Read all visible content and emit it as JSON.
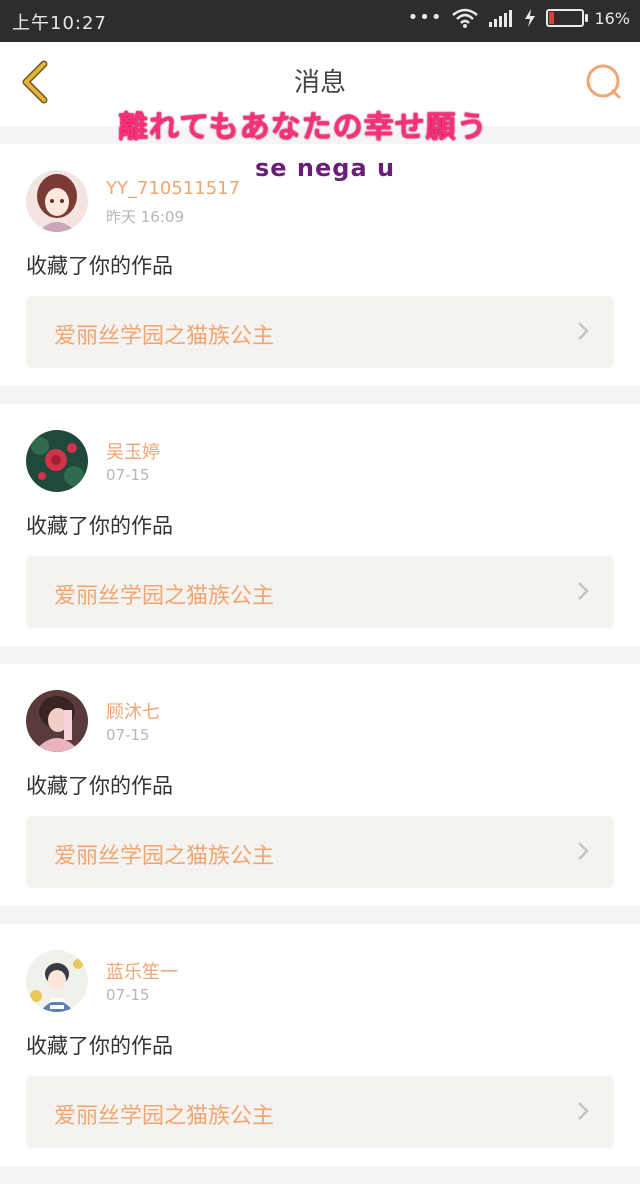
{
  "status_bar": {
    "time": "上午10:27",
    "battery_pct": "16%",
    "battery_level": 0.16,
    "battery_color": "#e03c3c"
  },
  "header": {
    "title": "消息",
    "accent": "#e8b23a"
  },
  "overlay": {
    "jp_text": "離れてもあなたの幸せ願う",
    "sub_text": "se nega u"
  },
  "notifications": [
    {
      "username": "YY_710511517",
      "time": "昨天 16:09",
      "action": "收藏了你的作品",
      "work_title": "爱丽丝学园之猫族公主",
      "avatar_icon": "avatar-anime-girl"
    },
    {
      "username": "吴玉婷",
      "time": "07-15",
      "action": "收藏了你的作品",
      "work_title": "爱丽丝学园之猫族公主",
      "avatar_icon": "avatar-red-flower"
    },
    {
      "username": "顾沐七",
      "time": "07-15",
      "action": "收藏了你的作品",
      "work_title": "爱丽丝学园之猫族公主",
      "avatar_icon": "avatar-pink-portrait"
    },
    {
      "username": "蓝乐笙一",
      "time": "07-15",
      "action": "收藏了你的作品",
      "work_title": "爱丽丝学园之猫族公主",
      "avatar_icon": "avatar-boy"
    }
  ]
}
